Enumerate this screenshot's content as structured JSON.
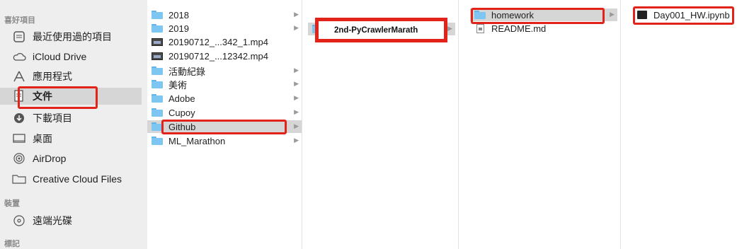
{
  "sidebar": {
    "favorites_header": "喜好項目",
    "items": [
      {
        "label": "最近使用過的項目",
        "icon": "recents-icon"
      },
      {
        "label": "iCloud Drive",
        "icon": "cloud-icon"
      },
      {
        "label": "應用程式",
        "icon": "applications-icon"
      },
      {
        "label": "文件",
        "icon": "documents-icon"
      },
      {
        "label": "下載項目",
        "icon": "downloads-icon"
      },
      {
        "label": "桌面",
        "icon": "desktop-icon"
      },
      {
        "label": "AirDrop",
        "icon": "airdrop-icon"
      },
      {
        "label": "Creative Cloud Files",
        "icon": "folder-icon"
      }
    ],
    "devices_header": "裝置",
    "devices": [
      {
        "label": "遠端光碟",
        "icon": "remote-disc-icon"
      }
    ],
    "tags_header": "標記"
  },
  "column1": {
    "items": [
      {
        "label": "2018",
        "kind": "folder",
        "chevron": true
      },
      {
        "label": "2019",
        "kind": "folder",
        "chevron": true
      },
      {
        "label": "20190712_...342_1.mp4",
        "kind": "video",
        "chevron": false
      },
      {
        "label": "20190712_...12342.mp4",
        "kind": "video",
        "chevron": false
      },
      {
        "label": "活動紀錄",
        "kind": "folder",
        "chevron": true
      },
      {
        "label": "美術",
        "kind": "folder",
        "chevron": true
      },
      {
        "label": "Adobe",
        "kind": "folder",
        "chevron": true
      },
      {
        "label": "Cupoy",
        "kind": "folder",
        "chevron": true
      },
      {
        "label": "Github",
        "kind": "folder",
        "chevron": true,
        "selected": true
      },
      {
        "label": "ML_Marathon",
        "kind": "folder",
        "chevron": true
      }
    ]
  },
  "column2": {
    "items": [
      {
        "label": "2nd-PyCrawlerMarath",
        "kind": "folder",
        "chevron": true,
        "selected": true
      }
    ]
  },
  "column3": {
    "items": [
      {
        "label": "homework",
        "kind": "folder",
        "chevron": true,
        "selected": true
      },
      {
        "label": "README.md",
        "kind": "document",
        "chevron": false
      }
    ]
  },
  "column4": {
    "items": [
      {
        "label": "Day001_HW.ipynb",
        "kind": "notebook",
        "chevron": false
      }
    ]
  },
  "colors": {
    "highlight": "#e2231a",
    "selection": "#d6d6d6",
    "sidebar_bg": "#eeeeee",
    "folder_blue": "#7ec6f2"
  }
}
